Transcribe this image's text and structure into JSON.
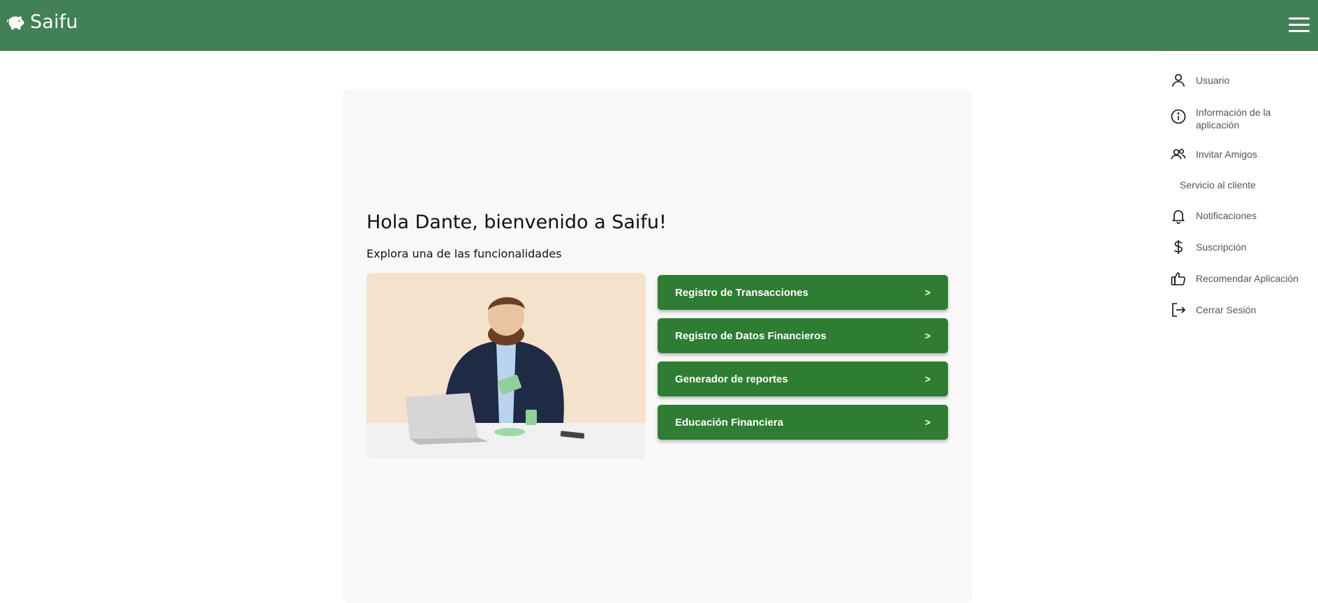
{
  "navbar": {
    "brand": "Saifu",
    "logo_icon": "piggy-bank-icon",
    "menu_icon": "hamburger-menu-icon",
    "background": "#428055"
  },
  "main": {
    "greeting": "Hola Dante, bienvenido a Saifu!",
    "subtitle": "Explora una de las funcionalidades",
    "features": [
      {
        "label": "Registro de Transacciones",
        "arrow": ">"
      },
      {
        "label": "Registro de Datos Financieros",
        "arrow": ">"
      },
      {
        "label": "Generador de reportes",
        "arrow": ">"
      },
      {
        "label": "Educación Financiera",
        "arrow": ">"
      }
    ],
    "button_color": "#2e7d32"
  },
  "menu": {
    "items": [
      {
        "label": "Usuario",
        "icon": "user-icon"
      },
      {
        "label": "Información de la aplicación",
        "icon": "info-icon"
      },
      {
        "label": "Invitar Amigos",
        "icon": "users-icon"
      },
      {
        "label": "Servicio al cliente",
        "icon": ""
      },
      {
        "label": "Notificaciones",
        "icon": "bell-icon"
      },
      {
        "label": "Suscripción",
        "icon": "dollar-icon"
      },
      {
        "label": "Recomendar Aplicación",
        "icon": "thumbs-up-icon"
      },
      {
        "label": "Cerrar Sesión",
        "icon": "logout-icon"
      }
    ]
  }
}
